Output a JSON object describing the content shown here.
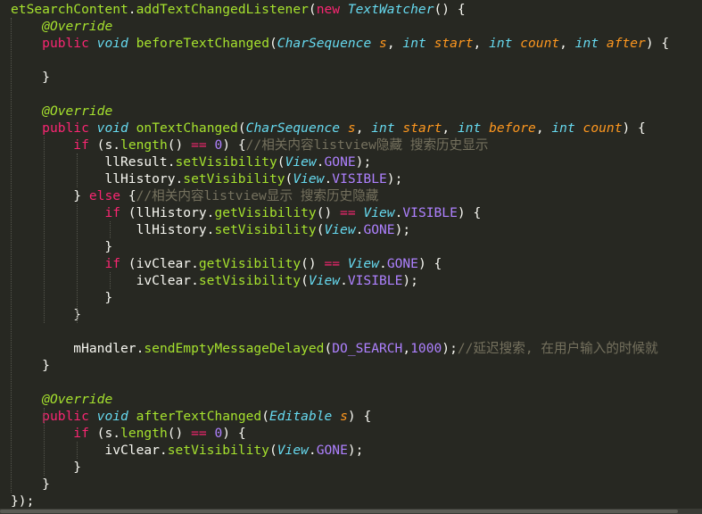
{
  "theme": {
    "background": "#272822",
    "default": "#f8f8f2",
    "function": "#a6e22e",
    "keyword": "#f92672",
    "type": "#66d9ef",
    "parameter": "#fd971f",
    "constant": "#ae81ff",
    "comment": "#75715e"
  },
  "code": {
    "lines": [
      [
        [
          "fn",
          "etSearchContent"
        ],
        [
          "pl",
          "."
        ],
        [
          "fn",
          "addTextChangedListener"
        ],
        [
          "pl",
          "("
        ],
        [
          "kw",
          "new"
        ],
        [
          "pl",
          " "
        ],
        [
          "ty",
          "TextWatcher"
        ],
        [
          "pl",
          "() {"
        ]
      ],
      [
        [
          "pl",
          "    "
        ],
        [
          "an",
          "@Override"
        ]
      ],
      [
        [
          "pl",
          "    "
        ],
        [
          "kw",
          "public"
        ],
        [
          "pl",
          " "
        ],
        [
          "ty",
          "void"
        ],
        [
          "pl",
          " "
        ],
        [
          "fn",
          "beforeTextChanged"
        ],
        [
          "pl",
          "("
        ],
        [
          "ty",
          "CharSequence"
        ],
        [
          "pl",
          " "
        ],
        [
          "pa",
          "s"
        ],
        [
          "pl",
          ", "
        ],
        [
          "ty",
          "int"
        ],
        [
          "pl",
          " "
        ],
        [
          "pa",
          "start"
        ],
        [
          "pl",
          ", "
        ],
        [
          "ty",
          "int"
        ],
        [
          "pl",
          " "
        ],
        [
          "pa",
          "count"
        ],
        [
          "pl",
          ", "
        ],
        [
          "ty",
          "int"
        ],
        [
          "pl",
          " "
        ],
        [
          "pa",
          "after"
        ],
        [
          "pl",
          ") {"
        ]
      ],
      [
        [
          "pl",
          ""
        ]
      ],
      [
        [
          "pl",
          "    }"
        ]
      ],
      [
        [
          "pl",
          ""
        ]
      ],
      [
        [
          "pl",
          "    "
        ],
        [
          "an",
          "@Override"
        ]
      ],
      [
        [
          "pl",
          "    "
        ],
        [
          "kw",
          "public"
        ],
        [
          "pl",
          " "
        ],
        [
          "ty",
          "void"
        ],
        [
          "pl",
          " "
        ],
        [
          "fn",
          "onTextChanged"
        ],
        [
          "pl",
          "("
        ],
        [
          "ty",
          "CharSequence"
        ],
        [
          "pl",
          " "
        ],
        [
          "pa",
          "s"
        ],
        [
          "pl",
          ", "
        ],
        [
          "ty",
          "int"
        ],
        [
          "pl",
          " "
        ],
        [
          "pa",
          "start"
        ],
        [
          "pl",
          ", "
        ],
        [
          "ty",
          "int"
        ],
        [
          "pl",
          " "
        ],
        [
          "pa",
          "before"
        ],
        [
          "pl",
          ", "
        ],
        [
          "ty",
          "int"
        ],
        [
          "pl",
          " "
        ],
        [
          "pa",
          "count"
        ],
        [
          "pl",
          ") {"
        ]
      ],
      [
        [
          "pl",
          "        "
        ],
        [
          "kw",
          "if"
        ],
        [
          "pl",
          " (s."
        ],
        [
          "fn",
          "length"
        ],
        [
          "pl",
          "() "
        ],
        [
          "kw",
          "=="
        ],
        [
          "pl",
          " "
        ],
        [
          "nu",
          "0"
        ],
        [
          "pl",
          ") {"
        ],
        [
          "cm",
          "//相关内容listview隐藏 搜索历史显示"
        ]
      ],
      [
        [
          "pl",
          "            llResult."
        ],
        [
          "fn",
          "setVisibility"
        ],
        [
          "pl",
          "("
        ],
        [
          "cl",
          "View"
        ],
        [
          "pl",
          "."
        ],
        [
          "co",
          "GONE"
        ],
        [
          "pl",
          ");"
        ]
      ],
      [
        [
          "pl",
          "            llHistory."
        ],
        [
          "fn",
          "setVisibility"
        ],
        [
          "pl",
          "("
        ],
        [
          "cl",
          "View"
        ],
        [
          "pl",
          "."
        ],
        [
          "co",
          "VISIBLE"
        ],
        [
          "pl",
          ");"
        ]
      ],
      [
        [
          "pl",
          "        } "
        ],
        [
          "kw",
          "else"
        ],
        [
          "pl",
          " {"
        ],
        [
          "cm",
          "//相关内容listview显示 搜索历史隐藏"
        ]
      ],
      [
        [
          "pl",
          "            "
        ],
        [
          "kw",
          "if"
        ],
        [
          "pl",
          " (llHistory."
        ],
        [
          "fn",
          "getVisibility"
        ],
        [
          "pl",
          "() "
        ],
        [
          "kw",
          "=="
        ],
        [
          "pl",
          " "
        ],
        [
          "cl",
          "View"
        ],
        [
          "pl",
          "."
        ],
        [
          "co",
          "VISIBLE"
        ],
        [
          "pl",
          ") {"
        ]
      ],
      [
        [
          "pl",
          "                llHistory."
        ],
        [
          "fn",
          "setVisibility"
        ],
        [
          "pl",
          "("
        ],
        [
          "cl",
          "View"
        ],
        [
          "pl",
          "."
        ],
        [
          "co",
          "GONE"
        ],
        [
          "pl",
          ");"
        ]
      ],
      [
        [
          "pl",
          "            }"
        ]
      ],
      [
        [
          "pl",
          "            "
        ],
        [
          "kw",
          "if"
        ],
        [
          "pl",
          " (ivClear."
        ],
        [
          "fn",
          "getVisibility"
        ],
        [
          "pl",
          "() "
        ],
        [
          "kw",
          "=="
        ],
        [
          "pl",
          " "
        ],
        [
          "cl",
          "View"
        ],
        [
          "pl",
          "."
        ],
        [
          "co",
          "GONE"
        ],
        [
          "pl",
          ") {"
        ]
      ],
      [
        [
          "pl",
          "                ivClear."
        ],
        [
          "fn",
          "setVisibility"
        ],
        [
          "pl",
          "("
        ],
        [
          "cl",
          "View"
        ],
        [
          "pl",
          "."
        ],
        [
          "co",
          "VISIBLE"
        ],
        [
          "pl",
          ");"
        ]
      ],
      [
        [
          "pl",
          "            }"
        ]
      ],
      [
        [
          "pl",
          "        }"
        ]
      ],
      [
        [
          "pl",
          ""
        ]
      ],
      [
        [
          "pl",
          "        mHandler."
        ],
        [
          "fn",
          "sendEmptyMessageDelayed"
        ],
        [
          "pl",
          "("
        ],
        [
          "co",
          "DO_SEARCH"
        ],
        [
          "pl",
          ","
        ],
        [
          "nu",
          "1000"
        ],
        [
          "pl",
          ");"
        ],
        [
          "cm",
          "//延迟搜索, 在用户输入的时候就"
        ]
      ],
      [
        [
          "pl",
          "    }"
        ]
      ],
      [
        [
          "pl",
          ""
        ]
      ],
      [
        [
          "pl",
          "    "
        ],
        [
          "an",
          "@Override"
        ]
      ],
      [
        [
          "pl",
          "    "
        ],
        [
          "kw",
          "public"
        ],
        [
          "pl",
          " "
        ],
        [
          "ty",
          "void"
        ],
        [
          "pl",
          " "
        ],
        [
          "fn",
          "afterTextChanged"
        ],
        [
          "pl",
          "("
        ],
        [
          "ty",
          "Editable"
        ],
        [
          "pl",
          " "
        ],
        [
          "pa",
          "s"
        ],
        [
          "pl",
          ") {"
        ]
      ],
      [
        [
          "pl",
          "        "
        ],
        [
          "kw",
          "if"
        ],
        [
          "pl",
          " (s."
        ],
        [
          "fn",
          "length"
        ],
        [
          "pl",
          "() "
        ],
        [
          "kw",
          "=="
        ],
        [
          "pl",
          " "
        ],
        [
          "nu",
          "0"
        ],
        [
          "pl",
          ") {"
        ]
      ],
      [
        [
          "pl",
          "            ivClear."
        ],
        [
          "fn",
          "setVisibility"
        ],
        [
          "pl",
          "("
        ],
        [
          "cl",
          "View"
        ],
        [
          "pl",
          "."
        ],
        [
          "co",
          "GONE"
        ],
        [
          "pl",
          ");"
        ]
      ],
      [
        [
          "pl",
          "        }"
        ]
      ],
      [
        [
          "pl",
          "    }"
        ]
      ],
      [
        [
          "pl",
          "});"
        ]
      ]
    ]
  }
}
